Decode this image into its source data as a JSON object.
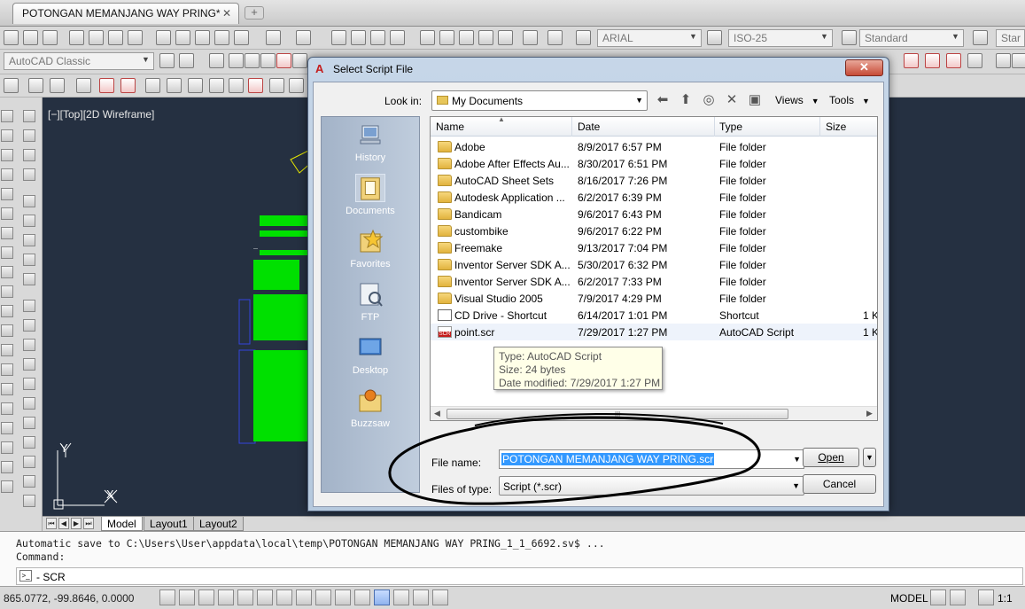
{
  "app": {
    "document_tab": "POTONGAN MEMANJANG WAY PRING*",
    "tab_close": "✕",
    "new_tab": "+"
  },
  "toolbar": {
    "workspace": "AutoCAD Classic",
    "font_combo": "ARIAL",
    "dim_style_combo": "ISO-25",
    "table_style_combo": "Standard",
    "truncated_combo": "Star"
  },
  "viewport": {
    "label": "[−][Top][2D Wireframe]",
    "ucs_y": "Y",
    "ucs_x": "X"
  },
  "layout_tabs": [
    "Model",
    "Layout1",
    "Layout2"
  ],
  "command": {
    "history": [
      "Automatic save to C:\\Users\\User\\appdata\\local\\temp\\POTONGAN MEMANJANG WAY PRING_1_1_6692.sv$ ...",
      "Command:"
    ],
    "input": "- SCR"
  },
  "status": {
    "coordinates": "865.0772, -99.8646, 0.0000",
    "space": "MODEL",
    "scale": "1:1"
  },
  "dialog": {
    "title": "Select Script File",
    "close": "✕",
    "look_in_label": "Look in:",
    "look_in_value": "My Documents",
    "views_label": "Views",
    "tools_label": "Tools",
    "places": [
      {
        "label": "History",
        "icon": "history-icon"
      },
      {
        "label": "Documents",
        "icon": "documents-icon"
      },
      {
        "label": "Favorites",
        "icon": "favorites-icon"
      },
      {
        "label": "FTP",
        "icon": "ftp-icon"
      },
      {
        "label": "Desktop",
        "icon": "desktop-icon"
      },
      {
        "label": "Buzzsaw",
        "icon": "buzzsaw-icon"
      }
    ],
    "columns": {
      "name": "Name",
      "date": "Date",
      "type": "Type",
      "size": "Size"
    },
    "files": [
      {
        "name": "Adobe",
        "date": "8/9/2017 6:57 PM",
        "type": "File folder",
        "size": "",
        "icon": "folder"
      },
      {
        "name": "Adobe After Effects Au...",
        "date": "8/30/2017 6:51 PM",
        "type": "File folder",
        "size": "",
        "icon": "folder"
      },
      {
        "name": "AutoCAD Sheet Sets",
        "date": "8/16/2017 7:26 PM",
        "type": "File folder",
        "size": "",
        "icon": "folder"
      },
      {
        "name": "Autodesk Application ...",
        "date": "6/2/2017 6:39 PM",
        "type": "File folder",
        "size": "",
        "icon": "folder"
      },
      {
        "name": "Bandicam",
        "date": "9/6/2017 6:43 PM",
        "type": "File folder",
        "size": "",
        "icon": "folder"
      },
      {
        "name": "custombike",
        "date": "9/6/2017 6:22 PM",
        "type": "File folder",
        "size": "",
        "icon": "folder"
      },
      {
        "name": "Freemake",
        "date": "9/13/2017 7:04 PM",
        "type": "File folder",
        "size": "",
        "icon": "folder"
      },
      {
        "name": "Inventor Server SDK A...",
        "date": "5/30/2017 6:32 PM",
        "type": "File folder",
        "size": "",
        "icon": "folder"
      },
      {
        "name": "Inventor Server SDK A...",
        "date": "6/2/2017 7:33 PM",
        "type": "File folder",
        "size": "",
        "icon": "folder"
      },
      {
        "name": "Visual Studio 2005",
        "date": "7/9/2017 4:29 PM",
        "type": "File folder",
        "size": "",
        "icon": "folder"
      },
      {
        "name": "CD Drive - Shortcut",
        "date": "6/14/2017 1:01 PM",
        "type": "Shortcut",
        "size": "1 K",
        "icon": "shortcut"
      },
      {
        "name": "point.scr",
        "date": "7/29/2017 1:27 PM",
        "type": "AutoCAD Script",
        "size": "1 K",
        "icon": "script"
      }
    ],
    "tooltip": {
      "type": "Type: AutoCAD Script",
      "size": "Size: 24 bytes",
      "modified": "Date modified: 7/29/2017 1:27 PM"
    },
    "file_name_label": "File name:",
    "file_name_value": "POTONGAN MEMANJANG WAY PRING.scr",
    "files_of_type_label": "Files of type:",
    "files_of_type_value": "Script (*.scr)",
    "open_label": "Open",
    "cancel_label": "Cancel"
  },
  "colors": {
    "canvas": "#253041",
    "drawing": "#00e000",
    "annotation": "#000000"
  }
}
